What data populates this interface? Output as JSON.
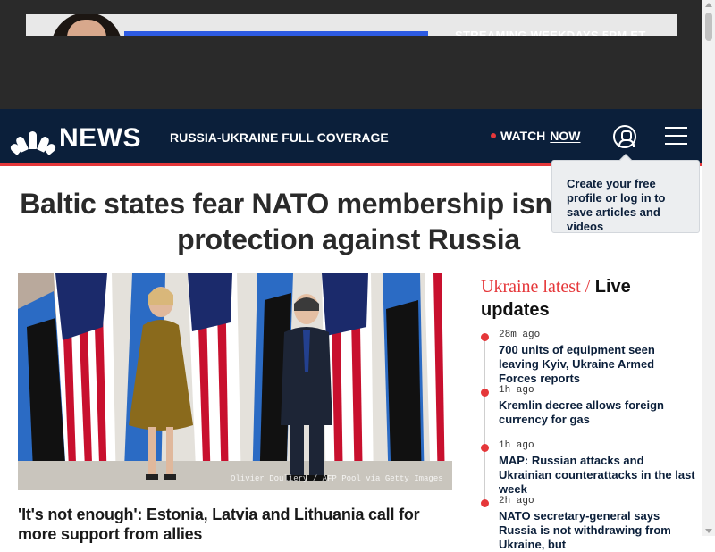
{
  "ad": {
    "text": "STREAMING WEEKDAYS 5PM ET"
  },
  "header": {
    "logo": "NEWS",
    "coverage_link": "RUSSIA-UKRAINE FULL COVERAGE",
    "watch_label": "WATCH",
    "watch_now": "NOW",
    "user_icon": "user-circle-icon",
    "menu_icon": "hamburger-menu-icon"
  },
  "tooltip": {
    "text": "Create your free profile or log in to save articles and videos"
  },
  "article": {
    "headline": "Baltic states fear NATO membership isn't enough protection against Russia",
    "image_caption": "Olivier Douliery / AFP Pool via Getty Images",
    "story_title": "'It's not enough': Estonia, Latvia and Lithuania call for more support from allies"
  },
  "rail": {
    "title_part1": "Ukraine latest /",
    "title_part2": "Live updates",
    "items": [
      {
        "time": "28m ago",
        "text": "700 units of equipment seen leaving Kyiv, Ukraine Armed Forces reports"
      },
      {
        "time": "1h ago",
        "text": "Kremlin decree allows foreign currency for gas"
      },
      {
        "time": "1h ago",
        "text": "MAP: Russian attacks and Ukrainian counterattacks in the last week"
      },
      {
        "time": "2h ago",
        "text": "NATO secretary-general says Russia is not withdrawing from Ukraine, but"
      }
    ]
  },
  "colors": {
    "navy": "#0b1f3a",
    "accent_red": "#e5373a"
  }
}
